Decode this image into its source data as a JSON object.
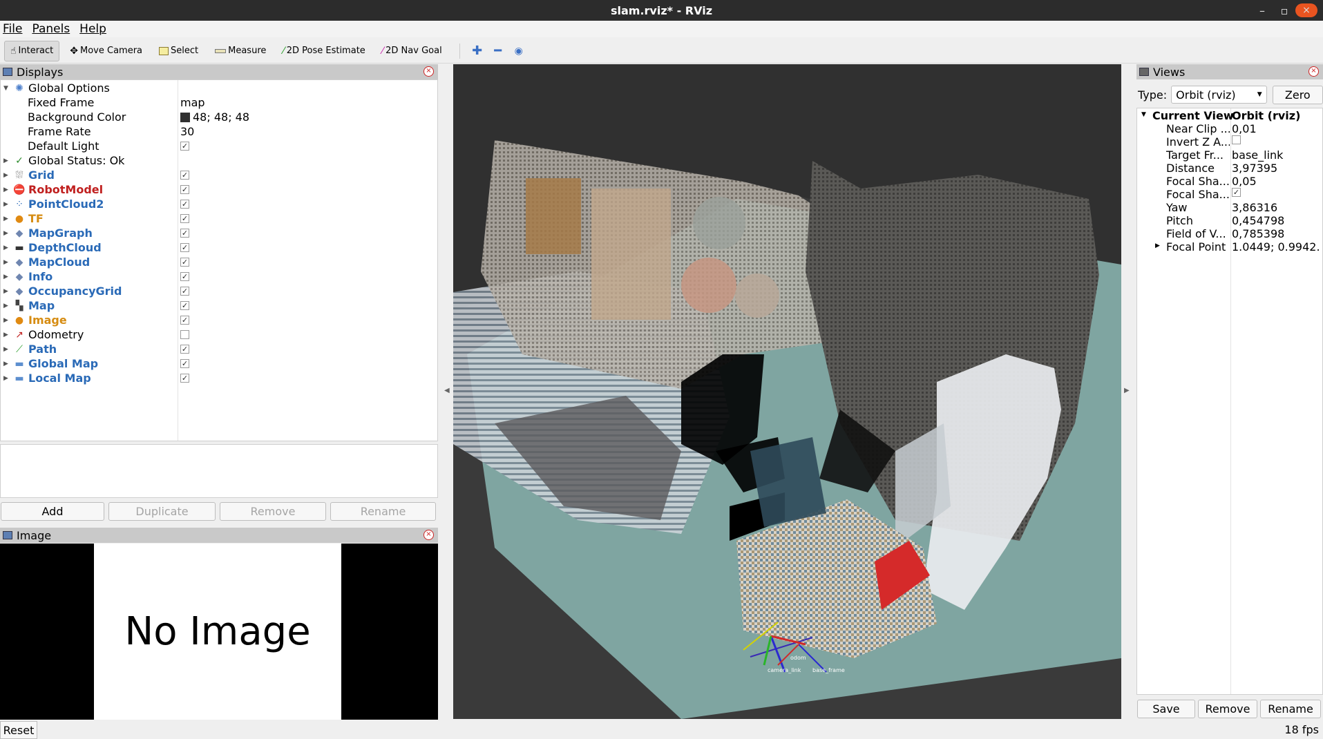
{
  "window": {
    "title": "slam.rviz* - RViz",
    "min": "–",
    "max": "▫",
    "close": "×"
  },
  "menu": [
    "File",
    "Panels",
    "Help"
  ],
  "toolbar": {
    "tools": [
      {
        "label": "Interact",
        "icon": "hand-icon"
      },
      {
        "label": "Move Camera",
        "icon": "move-camera-icon"
      },
      {
        "label": "Select",
        "icon": "select-icon"
      },
      {
        "label": "Measure",
        "icon": "ruler-icon"
      },
      {
        "label": "2D Pose Estimate",
        "icon": "pose-estimate-icon",
        "color": "#2a9d2a"
      },
      {
        "label": "2D Nav Goal",
        "icon": "nav-goal-icon",
        "color": "#cc2bb0"
      }
    ],
    "active": "Interact"
  },
  "displays": {
    "title": "Displays",
    "global_options": {
      "label": "Global Options",
      "props": [
        {
          "key": "Fixed Frame",
          "value": "map"
        },
        {
          "key": "Background Color",
          "value": "48; 48; 48",
          "color": "#303030"
        },
        {
          "key": "Frame Rate",
          "value": "30"
        },
        {
          "key": "Default Light",
          "value": "✓"
        }
      ]
    },
    "global_status": "Global Status: Ok",
    "items": [
      {
        "label": "Grid",
        "style": "blue",
        "icon": "grid-icon",
        "checked": "✓"
      },
      {
        "label": "RobotModel",
        "style": "red",
        "icon": "error-icon",
        "checked": "✓"
      },
      {
        "label": "PointCloud2",
        "style": "blue",
        "icon": "pointcloud-icon",
        "checked": "✓"
      },
      {
        "label": "TF",
        "style": "orange",
        "icon": "warning-icon",
        "checked": "✓"
      },
      {
        "label": "MapGraph",
        "style": "blue",
        "icon": "diamond-icon",
        "checked": "✓"
      },
      {
        "label": "DepthCloud",
        "style": "blue",
        "icon": "depthcloud-icon",
        "checked": "✓"
      },
      {
        "label": "MapCloud",
        "style": "blue",
        "icon": "diamond-icon",
        "checked": "✓"
      },
      {
        "label": "Info",
        "style": "blue",
        "icon": "diamond-icon",
        "checked": "✓"
      },
      {
        "label": "OccupancyGrid",
        "style": "blue",
        "icon": "diamond-icon",
        "checked": "✓"
      },
      {
        "label": "Map",
        "style": "blue",
        "icon": "map-icon",
        "checked": "✓"
      },
      {
        "label": "Image",
        "style": "orange",
        "icon": "warning-icon",
        "checked": "✓"
      },
      {
        "label": "Odometry",
        "style": "plain",
        "icon": "odometry-icon",
        "checked": ""
      },
      {
        "label": "Path",
        "style": "blue",
        "icon": "path-icon",
        "checked": "✓"
      },
      {
        "label": "Global Map",
        "style": "blue",
        "icon": "folder-icon",
        "checked": "✓"
      },
      {
        "label": "Local Map",
        "style": "blue",
        "icon": "folder-icon",
        "checked": "✓"
      }
    ],
    "buttons": {
      "add": "Add",
      "duplicate": "Duplicate",
      "remove": "Remove",
      "rename": "Rename"
    }
  },
  "image_panel": {
    "title": "Image",
    "text": "No Image"
  },
  "views": {
    "title": "Views",
    "type_label": "Type:",
    "type_value": "Orbit (rviz)",
    "zero": "Zero",
    "current_view": {
      "key": "Current View",
      "value": "Orbit (rviz)"
    },
    "props": [
      {
        "key": "Near Clip ...",
        "value": "0,01"
      },
      {
        "key": "Invert Z A...",
        "value": "",
        "checkbox": true
      },
      {
        "key": "Target Fr...",
        "value": "base_link"
      },
      {
        "key": "Distance",
        "value": "3,97395"
      },
      {
        "key": "Focal Sha...",
        "value": "0,05"
      },
      {
        "key": "Focal Sha...",
        "value": "✓",
        "checkbox": true
      },
      {
        "key": "Yaw",
        "value": "3,86316"
      },
      {
        "key": "Pitch",
        "value": "0,454798"
      },
      {
        "key": "Field of V...",
        "value": "0,785398"
      },
      {
        "key": "Focal Point",
        "value": "1.0449; 0.9942...",
        "expandable": true
      }
    ],
    "buttons": {
      "save": "Save",
      "remove": "Remove",
      "rename": "Rename"
    }
  },
  "viewport": {
    "tf_labels": [
      "odom",
      "camera_link",
      "base_frame"
    ]
  },
  "status": {
    "reset": "Reset",
    "fps": "18 fps"
  }
}
